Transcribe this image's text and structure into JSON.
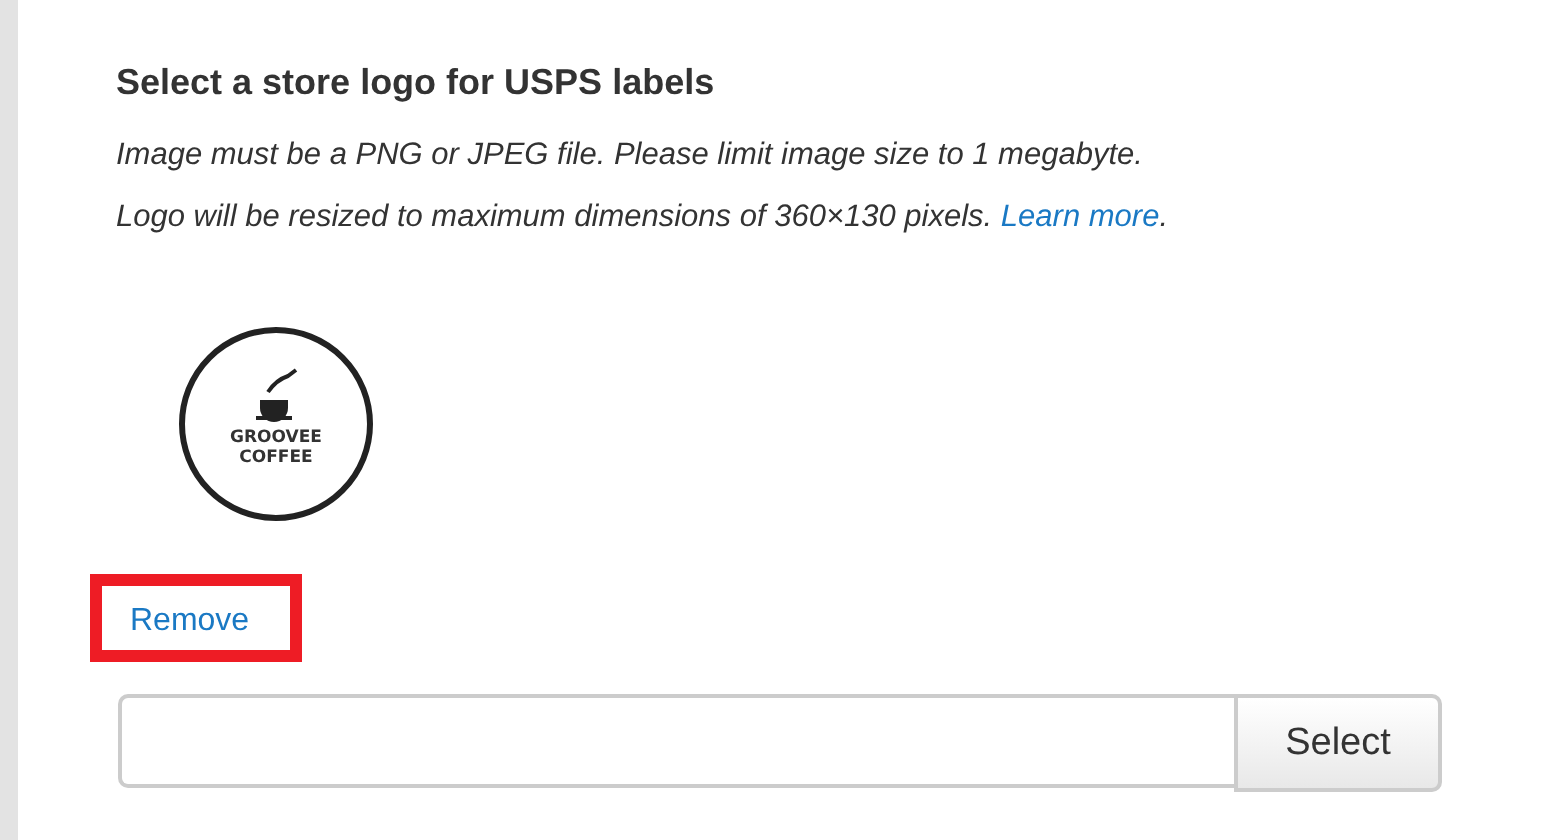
{
  "heading": "Select a store logo for USPS labels",
  "description_lines": [
    {
      "text": "Image must be a PNG or JPEG file. Please limit image size to 1 megabyte."
    },
    {
      "text": "Logo will be resized to maximum dimensions of 360×130 pixels. ",
      "link": "Learn more",
      "after": "."
    }
  ],
  "logo": {
    "line_1": "GROOVEE",
    "line_2": "COFFEE"
  },
  "remove_link": {
    "label": "Remove",
    "highlighted": true
  },
  "file_input": {
    "button": "Select"
  }
}
